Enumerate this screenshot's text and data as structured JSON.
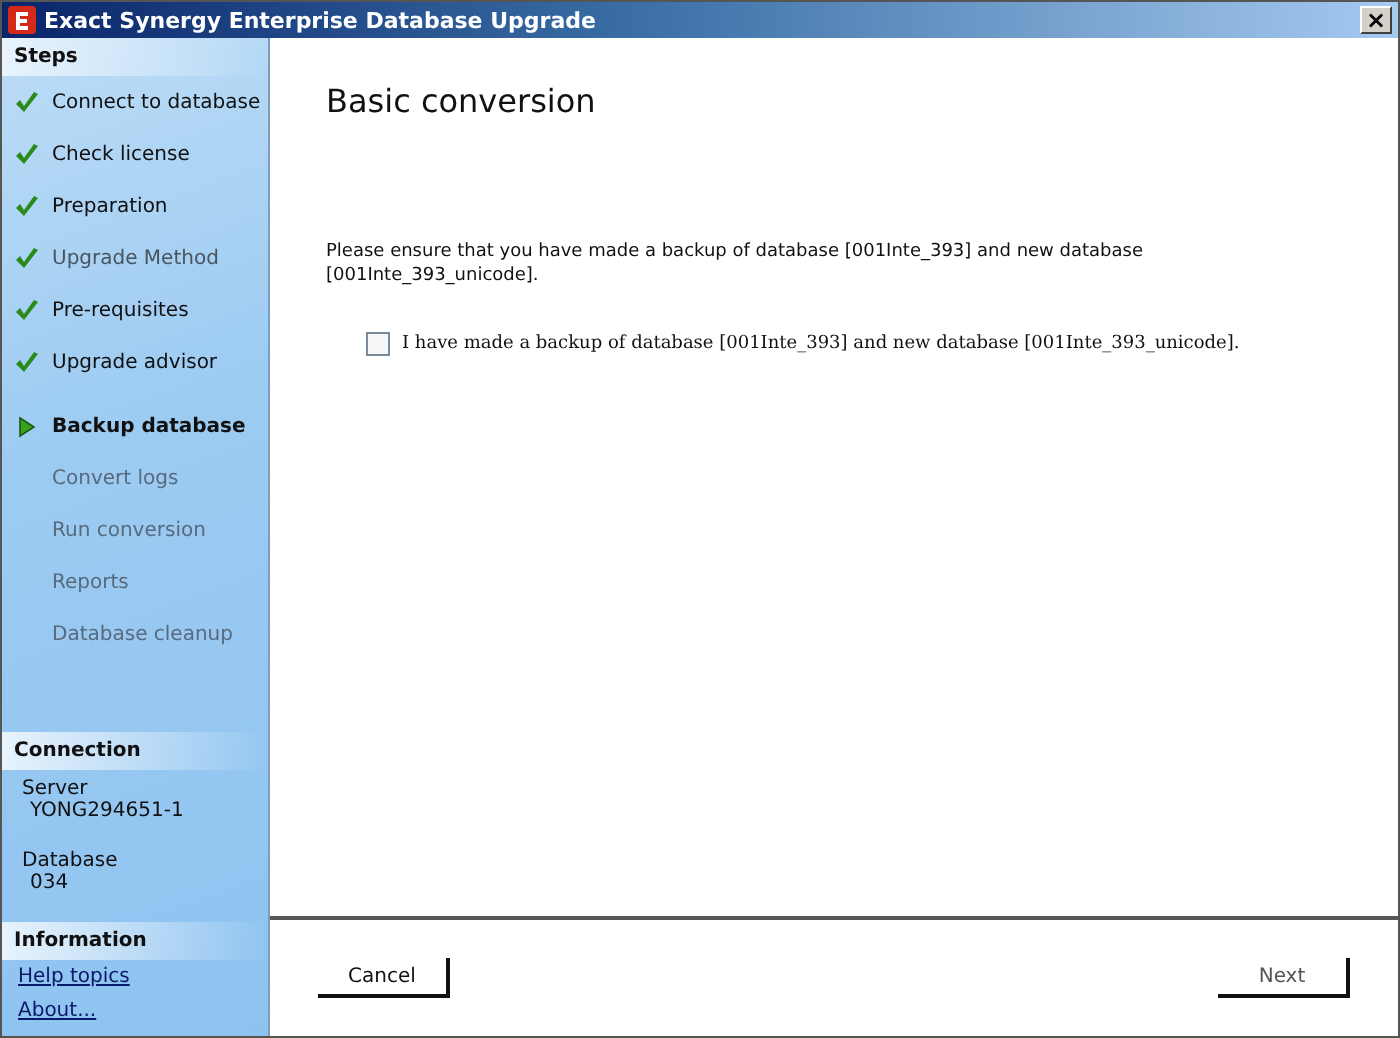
{
  "window": {
    "title": "Exact Synergy Enterprise Database Upgrade",
    "close": "×"
  },
  "sidebar": {
    "steps_heading": "Steps",
    "steps": [
      {
        "label": "Connect to database",
        "completed": true,
        "selected": false,
        "disabled": false
      },
      {
        "label": "Check license",
        "completed": true,
        "selected": false,
        "disabled": false
      },
      {
        "label": "Preparation",
        "completed": true,
        "selected": false,
        "disabled": false
      },
      {
        "label": "Upgrade Method",
        "completed": true,
        "selected": false,
        "disabled": true
      },
      {
        "label": "Pre-requisites",
        "completed": true,
        "selected": false,
        "disabled": false
      },
      {
        "label": "Upgrade advisor",
        "completed": true,
        "selected": false,
        "disabled": false
      },
      {
        "label": "Backup database",
        "completed": false,
        "selected": true,
        "disabled": false
      },
      {
        "label": "Convert logs",
        "completed": false,
        "selected": false,
        "disabled": true
      },
      {
        "label": "Run conversion",
        "completed": false,
        "selected": false,
        "disabled": true
      },
      {
        "label": "Reports",
        "completed": false,
        "selected": false,
        "disabled": true
      },
      {
        "label": "Database cleanup",
        "completed": false,
        "selected": false,
        "disabled": true
      }
    ],
    "connection_heading": "Connection",
    "connection": [
      {
        "label": "Server",
        "value": "YONG294651-1"
      },
      {
        "label": "Database",
        "value": "034"
      }
    ],
    "information_heading": "Information",
    "links": [
      "Help topics",
      "About..."
    ]
  },
  "content": {
    "title": "Basic conversion",
    "message": "Please ensure that you have made a backup of database [001Inte_393] and new database [001Inte_393_unicode].",
    "confirm": {
      "label": "I have made a backup of database [001Inte_393]  and new database [001Inte_393_unicode].",
      "checked": false
    }
  },
  "buttons": [
    {
      "label": "Cancel",
      "disabled": false
    },
    {
      "label": "Next",
      "disabled": true
    }
  ]
}
